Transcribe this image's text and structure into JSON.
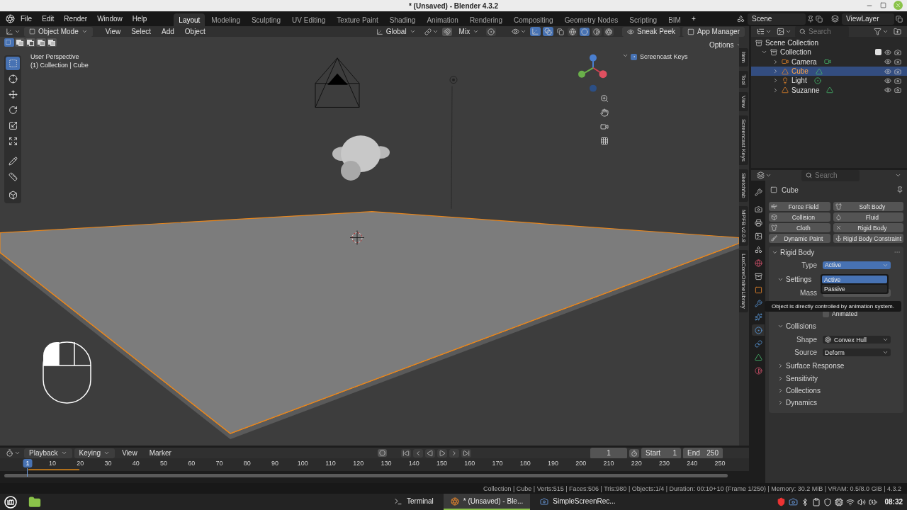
{
  "window": {
    "title": "* (Unsaved) - Blender 4.3.2"
  },
  "menu": [
    "File",
    "Edit",
    "Render",
    "Window",
    "Help"
  ],
  "workspaces": [
    {
      "label": "Layout",
      "selected": true
    },
    {
      "label": "Modeling",
      "selected": false
    },
    {
      "label": "Sculpting",
      "selected": false
    },
    {
      "label": "UV Editing",
      "selected": false
    },
    {
      "label": "Texture Paint",
      "selected": false
    },
    {
      "label": "Shading",
      "selected": false
    },
    {
      "label": "Animation",
      "selected": false
    },
    {
      "label": "Rendering",
      "selected": false
    },
    {
      "label": "Compositing",
      "selected": false
    },
    {
      "label": "Geometry Nodes",
      "selected": false
    },
    {
      "label": "Scripting",
      "selected": false
    },
    {
      "label": "BIM",
      "selected": false
    }
  ],
  "add_workspace": "+",
  "scene": "Scene",
  "view_layer": "ViewLayer",
  "viewport": {
    "mode": "Object Mode",
    "menu": [
      "View",
      "Select",
      "Add",
      "Object"
    ],
    "orientation": "Global",
    "snap_target": "Mix",
    "select_modes": [
      {
        "kind": "set",
        "selected": true
      },
      {
        "kind": "extend",
        "selected": false
      },
      {
        "kind": "subtract",
        "selected": false
      },
      {
        "kind": "invert",
        "selected": false
      },
      {
        "kind": "intersect",
        "selected": false
      }
    ],
    "shading": [
      {
        "kind": "wireframe",
        "selected": false
      },
      {
        "kind": "solid",
        "selected": true
      },
      {
        "kind": "material",
        "selected": false
      },
      {
        "kind": "rendered",
        "selected": false
      }
    ],
    "buttons": [
      "Sneak Peek",
      "App Manager"
    ],
    "options": "Options",
    "view_name": "User Perspective",
    "context": "(1) Collection | Cube",
    "screencast_keys": {
      "label": "Screencast Keys",
      "checked": true
    },
    "tools": [
      {
        "kind": "select",
        "selected": true
      },
      {
        "kind": "cursor",
        "selected": false
      },
      {
        "kind": "move",
        "selected": false
      },
      {
        "kind": "rotate",
        "selected": false
      },
      {
        "kind": "scale",
        "selected": false
      },
      {
        "kind": "transform",
        "selected": false
      },
      {
        "kind": "annotate",
        "selected": false
      },
      {
        "kind": "measure",
        "selected": false
      },
      {
        "kind": "add_cube",
        "selected": false
      }
    ],
    "sidebar_tabs": [
      "Item",
      "Tool",
      "View",
      "Screencast Keys",
      "Sketchfab",
      "MPFB v2.0.8",
      "LuxCoreOnlineLibrary"
    ]
  },
  "outliner": {
    "search_placeholder": "Search",
    "root": "Scene Collection",
    "tree": [
      {
        "name": "Collection",
        "expanded": true,
        "checked": true,
        "children": [
          {
            "name": "Camera",
            "kind": "camera",
            "selected": false,
            "expanded": false
          },
          {
            "name": "Cube",
            "kind": "mesh",
            "selected": true,
            "expanded": false
          },
          {
            "name": "Light",
            "kind": "light",
            "selected": false,
            "expanded": false
          },
          {
            "name": "Suzanne",
            "kind": "mesh",
            "selected": false,
            "expanded": false
          }
        ]
      }
    ]
  },
  "properties": {
    "search_placeholder": "Search",
    "object": "Cube",
    "tabs": [
      {
        "kind": "tool",
        "selected": false
      },
      {
        "kind": "render",
        "selected": false
      },
      {
        "kind": "output",
        "selected": false
      },
      {
        "kind": "view_layer",
        "selected": false
      },
      {
        "kind": "scene",
        "selected": false
      },
      {
        "kind": "world",
        "selected": false
      },
      {
        "kind": "collection",
        "selected": false
      },
      {
        "kind": "object",
        "selected": false
      },
      {
        "kind": "modifiers",
        "selected": false
      },
      {
        "kind": "particles",
        "selected": false
      },
      {
        "kind": "physics",
        "selected": true
      },
      {
        "kind": "constraints",
        "selected": false
      },
      {
        "kind": "data",
        "selected": false
      },
      {
        "kind": "material",
        "selected": false
      }
    ],
    "physics_buttons": [
      {
        "label": "Force Field",
        "kind": "force_field",
        "enabled": false
      },
      {
        "label": "Soft Body",
        "kind": "soft_body",
        "enabled": false
      },
      {
        "label": "Collision",
        "kind": "collision",
        "enabled": false
      },
      {
        "label": "Fluid",
        "kind": "fluid",
        "enabled": false
      },
      {
        "label": "Cloth",
        "kind": "cloth",
        "enabled": false
      },
      {
        "label": "Rigid Body",
        "enabled": true
      },
      {
        "label": "Dynamic Paint",
        "kind": "dynamic_paint",
        "enabled": false
      },
      {
        "label": "Rigid Body Constraint",
        "kind": "rigid_body_constraint",
        "enabled": false
      }
    ],
    "rigid_body": {
      "title": "Rigid Body",
      "expanded": true,
      "type_label": "Type",
      "type_value": "Active",
      "type_options": [
        {
          "label": "Active",
          "selected": true
        },
        {
          "label": "Passive",
          "selected": false
        }
      ],
      "settings": {
        "title": "Settings",
        "expanded": true,
        "mass_label": "Mass",
        "animated": {
          "label": "Animated",
          "checked": false
        }
      },
      "tooltip": "Object is directly controlled by animation system.",
      "collisions": {
        "title": "Collisions",
        "expanded": true,
        "shape_label": "Shape",
        "shape": "Convex Hull",
        "source_label": "Source",
        "source": "Deform"
      },
      "subpanels": [
        {
          "title": "Surface Response",
          "expanded": false
        },
        {
          "title": "Sensitivity",
          "expanded": false
        },
        {
          "title": "Collections",
          "expanded": false
        },
        {
          "title": "Dynamics",
          "expanded": false
        }
      ]
    }
  },
  "timeline": {
    "menu": [
      "Playback",
      "Keying",
      "View",
      "Marker"
    ],
    "current_frame": "1",
    "start_label": "Start",
    "start": "1",
    "end_label": "End",
    "end": "250",
    "playhead": "1",
    "ruler": [
      "10",
      "20",
      "30",
      "40",
      "50",
      "60",
      "70",
      "80",
      "90",
      "100",
      "110",
      "120",
      "130",
      "140",
      "150",
      "160",
      "170",
      "180",
      "190",
      "200",
      "210",
      "220",
      "230",
      "240",
      "250"
    ]
  },
  "status": "Collection | Cube | Verts:515 | Faces:506 | Tris:980 | Objects:1/4 | Duration: 00:10+10 (Frame 1/250) | Memory: 30.2 MiB | VRAM: 0.5/8.0 GiB | 4.3.2",
  "taskbar": {
    "tasks": [
      {
        "label": "Terminal",
        "kind": "terminal",
        "selected": false
      },
      {
        "label": "* (Unsaved) - Ble...",
        "kind": "blender",
        "selected": true
      },
      {
        "label": "SimpleScreenRec...",
        "kind": "recorder",
        "selected": false
      }
    ],
    "clock": "08:32"
  }
}
